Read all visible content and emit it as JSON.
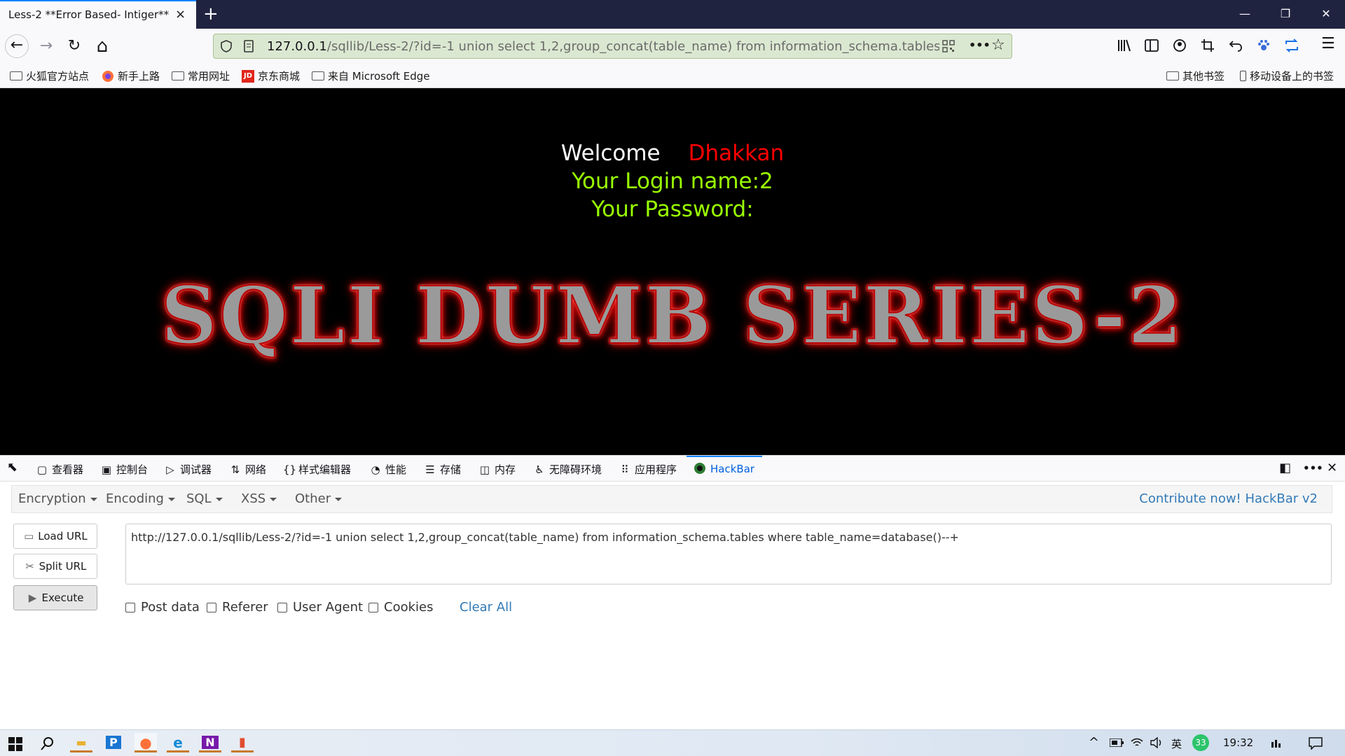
{
  "tab": {
    "title": "Less-2 **Error Based- Intiger**",
    "close_icon": "×",
    "new_tab_icon": "+"
  },
  "window_controls": {
    "minimize": "—",
    "restore": "❐",
    "close": "✕"
  },
  "nav": {
    "back_icon": "←",
    "forward_icon": "→",
    "reload_icon": "↻",
    "home_icon": "⌂",
    "url_host": "127.0.0.1",
    "url_rest": "/sqllib/Less-2/?id=-1 union select 1,2,group_concat(table_name) from information_schema.tables where ta",
    "more_icon": "•••",
    "star_icon": "☆",
    "menu_icon": "☰"
  },
  "bookmarks": {
    "items": [
      {
        "label": "火狐官方站点",
        "icon": "folder"
      },
      {
        "label": "新手上路",
        "icon": "firefox"
      },
      {
        "label": "常用网址",
        "icon": "folder"
      },
      {
        "label": "京东商城",
        "icon": "jd"
      },
      {
        "label": "来自 Microsoft Edge",
        "icon": "folder"
      }
    ],
    "other": "其他书签",
    "mobile": "移动设备上的书签",
    "jd_badge": "JD"
  },
  "page": {
    "welcome": "Welcome",
    "user": "Dhakkan",
    "login_line": "Your Login name:2",
    "password_line": "Your Password:",
    "banner": "SQLI DUMB SERIES-2",
    "colors": {
      "welcome": "#ffffff",
      "user": "#ff0000",
      "login": "#99ff00",
      "password": "#99ff00"
    }
  },
  "devtools": {
    "tabs": [
      {
        "label": "查看器",
        "icon": "▢"
      },
      {
        "label": "控制台",
        "icon": "▣"
      },
      {
        "label": "调试器",
        "icon": "▷"
      },
      {
        "label": "网络",
        "icon": "⇅"
      },
      {
        "label": "样式编辑器",
        "icon": "{}"
      },
      {
        "label": "性能",
        "icon": "◔"
      },
      {
        "label": "存储",
        "icon": "☰"
      },
      {
        "label": "内存",
        "icon": "◫"
      },
      {
        "label": "无障碍环境",
        "icon": "♿"
      },
      {
        "label": "应用程序",
        "icon": "⠿"
      }
    ],
    "active_tab": "HackBar",
    "picker_icon": "⬉",
    "dock_icon": "◧",
    "more_icon": "•••",
    "close_icon": "✕"
  },
  "hackbar": {
    "menu": [
      "Encryption",
      "Encoding",
      "SQL",
      "XSS",
      "Other"
    ],
    "contribute": "Contribute now! HackBar v2",
    "buttons": {
      "load": "Load URL",
      "split": "Split URL",
      "execute": "Execute"
    },
    "url_value": "http://127.0.0.1/sqllib/Less-2/?id=-1 union select 1,2,group_concat(table_name) from information_schema.tables where table_name=database()--+",
    "checkboxes": [
      "Post data",
      "Referer",
      "User Agent",
      "Cookies"
    ],
    "clear": "Clear All"
  },
  "taskbar": {
    "apps": [
      {
        "name": "explorer",
        "glyph": "▬",
        "color": "#e8b130"
      },
      {
        "name": "p-app",
        "glyph": "P",
        "color": "#1976d2"
      },
      {
        "name": "firefox",
        "glyph": "●",
        "color": "#ff7139"
      },
      {
        "name": "edge",
        "glyph": "e",
        "color": "#0f8bd6"
      },
      {
        "name": "onenote",
        "glyph": "N",
        "color": "#7719aa"
      },
      {
        "name": "app6",
        "glyph": "▮",
        "color": "#e04d2e"
      }
    ],
    "tray_up": "^",
    "ime": "英",
    "badge": "33",
    "time": "19:32"
  }
}
